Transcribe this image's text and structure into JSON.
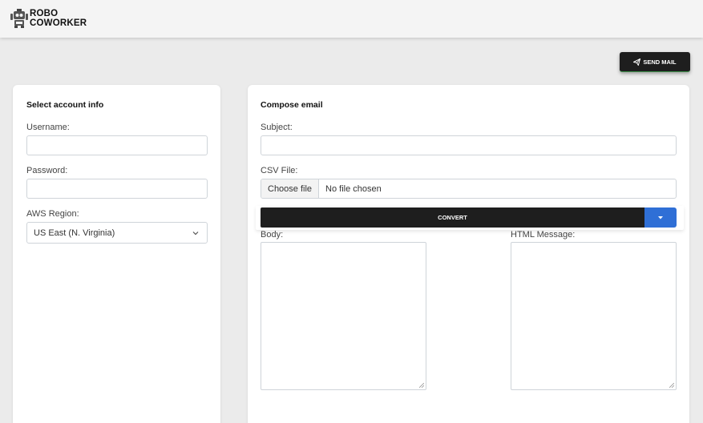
{
  "header": {
    "logo_line1": "ROBO",
    "logo_line2": "COWORKER"
  },
  "toolbar": {
    "send_mail_label": "SEND MAIL"
  },
  "account": {
    "title": "Select account info",
    "username_label": "Username:",
    "username_value": "",
    "password_label": "Password:",
    "password_value": "",
    "region_label": "AWS Region:",
    "region_selected": "US East (N. Virginia)"
  },
  "compose": {
    "title": "Compose email",
    "subject_label": "Subject:",
    "subject_value": "",
    "csv_label": "CSV File:",
    "csv_button": "Choose file",
    "csv_status": "No file chosen",
    "convert_label": "CONVERT",
    "body_label": "Body:",
    "html_label": "HTML Message:"
  },
  "colors": {
    "primary_dark": "#1e1e1e",
    "accent_blue": "#2f6fd6",
    "page_bg": "#ebebeb"
  }
}
